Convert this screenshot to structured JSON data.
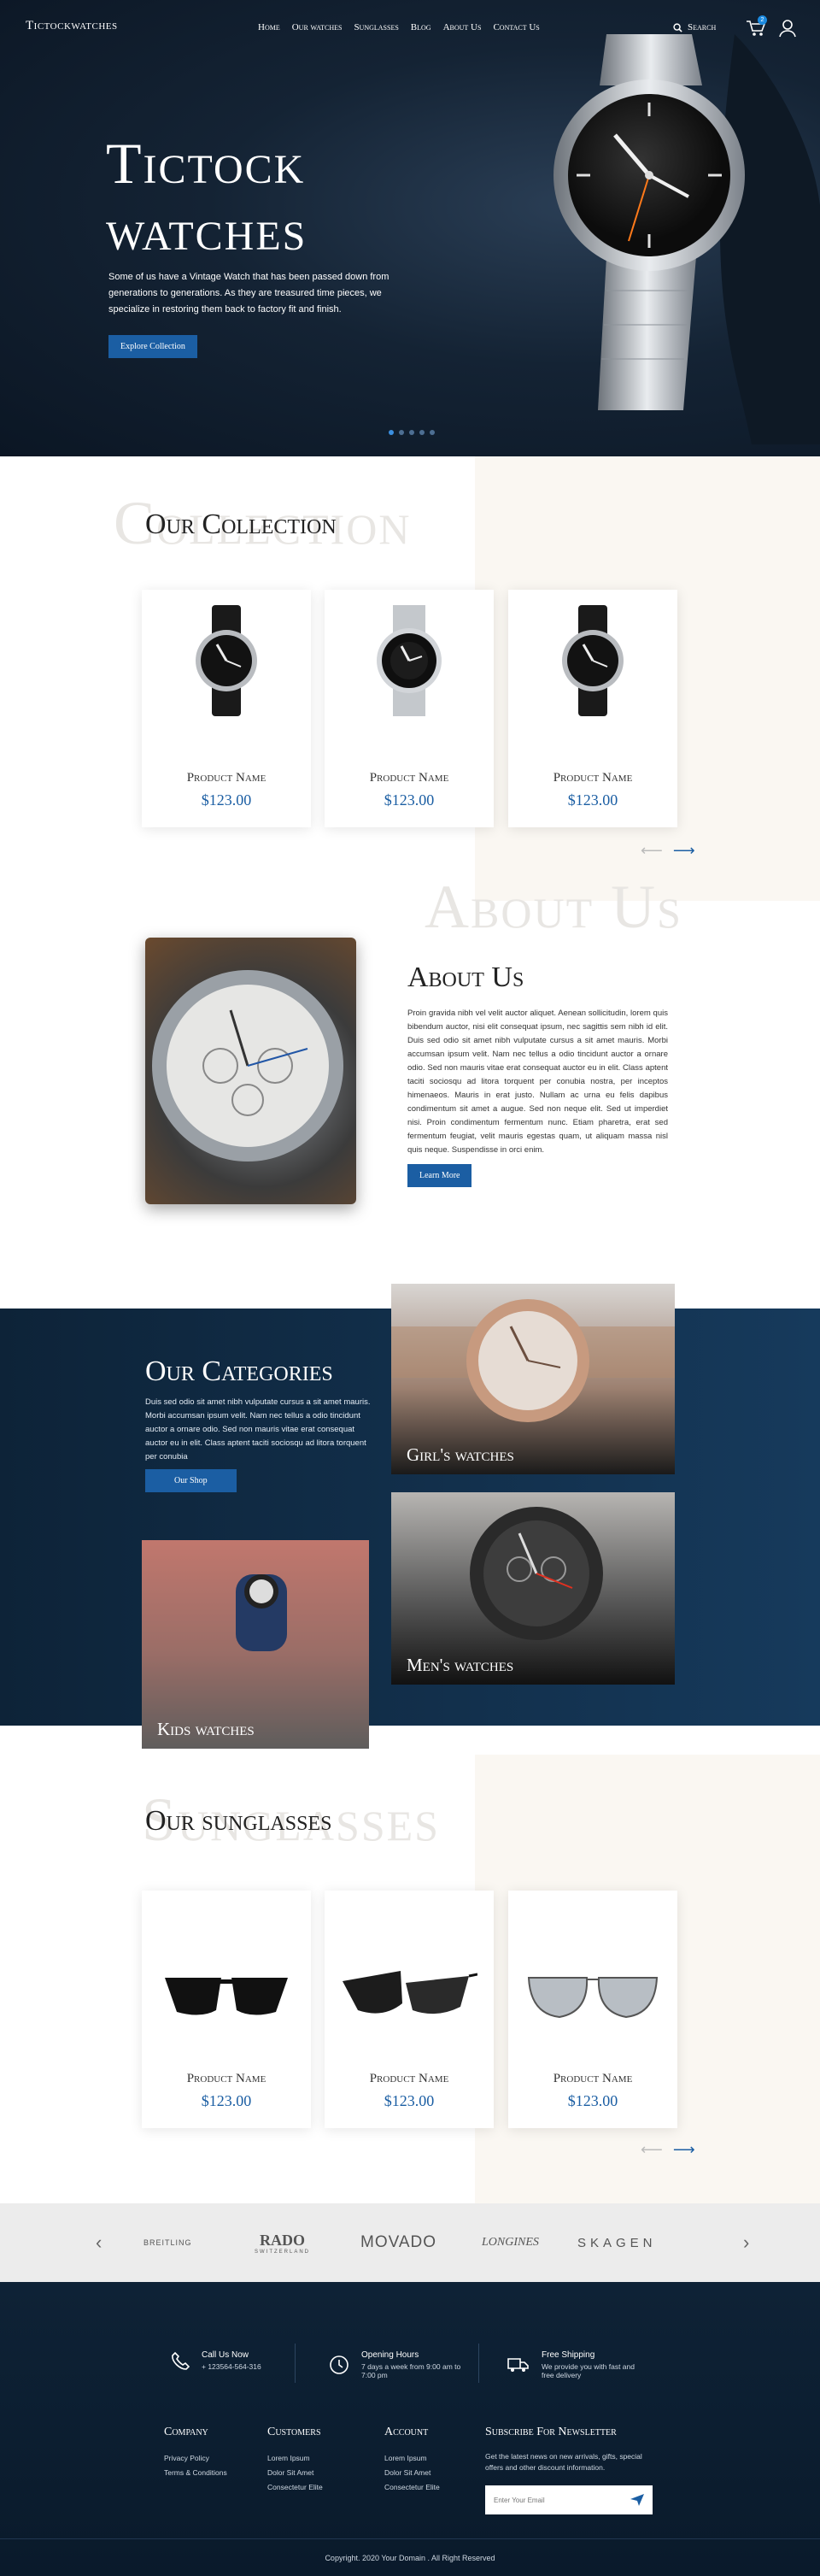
{
  "header": {
    "logo": "Tictockwatches",
    "nav": [
      "Home",
      "Our watches",
      "Sunglasses",
      "Blog",
      "About Us",
      "Contact Us"
    ],
    "search_label": "Search",
    "cart_count": "2"
  },
  "hero": {
    "title_line1": "Tictock",
    "title_line2": "watches",
    "tagline": "Some of us have a Vintage Watch that has been passed down from generations to generations. As they are treasured time pieces, we specialize in restoring them back to factory fit and finish.",
    "cta": "Explore Collection",
    "slides": 5,
    "active_slide": 1
  },
  "collection": {
    "bg_text": "Collection",
    "heading": "Our Collection",
    "products": [
      {
        "name": "Product Name",
        "price": "$123.00"
      },
      {
        "name": "Product Name",
        "price": "$123.00"
      },
      {
        "name": "Product Name",
        "price": "$123.00"
      }
    ]
  },
  "about": {
    "bg_text": "About Us",
    "heading": "About Us",
    "body": "Proin gravida nibh vel velit auctor aliquet. Aenean sollicitudin, lorem quis bibendum auctor, nisi elit consequat ipsum, nec sagittis sem nibh id elit. Duis sed odio sit amet nibh vulputate cursus a sit amet mauris. Morbi accumsan ipsum velit. Nam nec tellus a odio tincidunt auctor a ornare odio. Sed non mauris vitae erat consequat auctor eu in elit. Class aptent taciti sociosqu ad litora torquent per conubia nostra, per inceptos himenaeos. Mauris in erat justo. Nullam ac urna eu felis dapibus condimentum sit amet a augue. Sed non neque elit. Sed ut imperdiet nisi. Proin condimentum fermentum nunc. Etiam pharetra, erat sed fermentum feugiat, velit mauris egestas quam, ut aliquam massa nisl quis neque. Suspendisse in orci enim.",
    "cta": "Learn More"
  },
  "categories": {
    "heading": "Our Categories",
    "body": "Duis sed odio sit amet nibh vulputate cursus a sit amet mauris. Morbi accumsan ipsum velit. Nam nec tellus a odio tincidunt auctor a ornare odio. Sed non mauris vitae erat consequat auctor eu in elit. Class aptent taciti sociosqu ad litora torquent per conubia",
    "cta": "Our Shop",
    "tiles": [
      "Girl's watches",
      "Men's watches",
      "Kids watches"
    ]
  },
  "sunglasses": {
    "bg_text": "Sunglasses",
    "heading": "Our sunglasses",
    "products": [
      {
        "name": "Product Name",
        "price": "$123.00"
      },
      {
        "name": "Product Name",
        "price": "$123.00"
      },
      {
        "name": "Product Name",
        "price": "$123.00"
      }
    ]
  },
  "brands": [
    "BREITLING",
    "RADO",
    "MOVADO",
    "LONGINES",
    "SKAGEN"
  ],
  "brand_sub": {
    "rado": "SWITZERLAND"
  },
  "footer": {
    "features": [
      {
        "title": "Call Us Now",
        "text": "+ 123564-564-316"
      },
      {
        "title": "Opening Hours",
        "text": "7 days a week from 9:00 am to 7:00 pm"
      },
      {
        "title": "Free Shipping",
        "text": "We provide you with fast and free delivery"
      }
    ],
    "company": {
      "title": "Company",
      "links": [
        "Privacy Policy",
        "Terms & Conditions"
      ]
    },
    "customers": {
      "title": "Customers",
      "links": [
        "Lorem Ipsum",
        "Dolor Sit Amet",
        "Consectetur Elite"
      ]
    },
    "account": {
      "title": "Account",
      "links": [
        "Lorem Ipsum",
        "Dolor Sit Amet",
        "Consectetur Elite"
      ]
    },
    "newsletter": {
      "title": "Subscribe For Newsletter",
      "text": "Get the latest news on new arrivals, gifts, special offers and other discount information.",
      "placeholder": "Enter Your Email"
    },
    "copyright": "Copyright. 2020 Your Domain . All Right Reserved"
  },
  "colors": {
    "accent": "#1b5ea3",
    "navy": "#0d2338"
  }
}
